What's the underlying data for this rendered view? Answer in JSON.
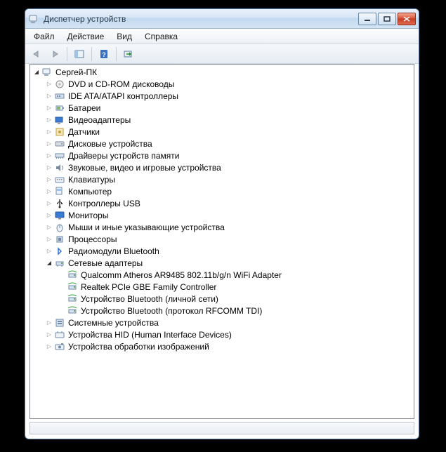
{
  "window": {
    "title": "Диспетчер устройств"
  },
  "menu": {
    "file": "Файл",
    "action": "Действие",
    "view": "Вид",
    "help": "Справка"
  },
  "tree": {
    "root": {
      "label": "Сергей-ПК",
      "expanded": true,
      "icon": "computer"
    },
    "categories": [
      {
        "label": "DVD и CD-ROM дисководы",
        "icon": "disc",
        "expanded": false
      },
      {
        "label": "IDE ATA/ATAPI контроллеры",
        "icon": "controller",
        "expanded": false
      },
      {
        "label": "Батареи",
        "icon": "battery",
        "expanded": false
      },
      {
        "label": "Видеоадаптеры",
        "icon": "display-adapter",
        "expanded": false
      },
      {
        "label": "Датчики",
        "icon": "sensor",
        "expanded": false
      },
      {
        "label": "Дисковые устройства",
        "icon": "disk",
        "expanded": false
      },
      {
        "label": "Драйверы устройств памяти",
        "icon": "memory",
        "expanded": false
      },
      {
        "label": "Звуковые, видео и игровые устройства",
        "icon": "sound",
        "expanded": false
      },
      {
        "label": "Клавиатуры",
        "icon": "keyboard",
        "expanded": false
      },
      {
        "label": "Компьютер",
        "icon": "computer-cat",
        "expanded": false
      },
      {
        "label": "Контроллеры USB",
        "icon": "usb",
        "expanded": false
      },
      {
        "label": "Мониторы",
        "icon": "monitor",
        "expanded": false
      },
      {
        "label": "Мыши и иные указывающие устройства",
        "icon": "mouse",
        "expanded": false
      },
      {
        "label": "Процессоры",
        "icon": "cpu",
        "expanded": false
      },
      {
        "label": "Радиомодули Bluetooth",
        "icon": "bluetooth",
        "expanded": false
      },
      {
        "label": "Сетевые адаптеры",
        "icon": "network",
        "expanded": true,
        "children": [
          {
            "label": "Qualcomm Atheros AR9485 802.11b/g/n WiFi Adapter",
            "icon": "net-device"
          },
          {
            "label": "Realtek PCIe GBE Family Controller",
            "icon": "net-device"
          },
          {
            "label": "Устройство Bluetooth (личной сети)",
            "icon": "net-device"
          },
          {
            "label": "Устройство Bluetooth (протокол RFCOMM TDI)",
            "icon": "net-device"
          }
        ]
      },
      {
        "label": "Системные устройства",
        "icon": "system",
        "expanded": false
      },
      {
        "label": "Устройства HID (Human Interface Devices)",
        "icon": "hid",
        "expanded": false
      },
      {
        "label": "Устройства обработки изображений",
        "icon": "imaging",
        "expanded": false
      }
    ]
  }
}
